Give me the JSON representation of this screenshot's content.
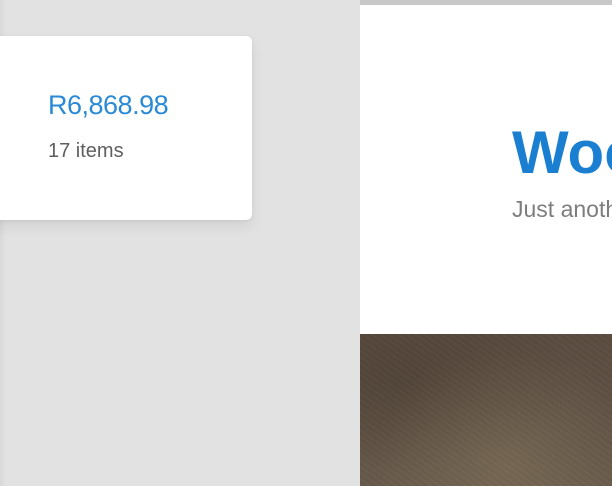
{
  "mini_cart": {
    "total": "R6,868.98",
    "count": "17 items"
  },
  "site_header": {
    "title": "Woo",
    "tagline": "Just another"
  },
  "colors": {
    "background": "#e2e2e2",
    "accent": "#2b8ad6",
    "title": "#1b7fd1",
    "muted_text": "#5f5f5f",
    "tagline": "#7d7d7d",
    "hero": "#5f5144"
  }
}
